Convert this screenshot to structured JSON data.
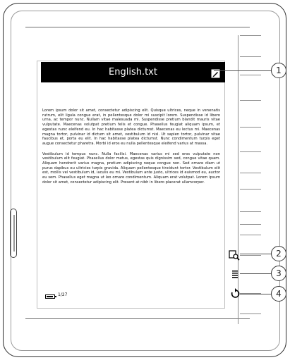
{
  "header": {
    "title": "English.txt"
  },
  "body_text": {
    "paragraphs": [
      "Lorem ipsum dolor sit amet, consectetur adipiscing elit. Quisque ultrices, neque in venenatis rutrum, elit ligula congue erat, in pellentesque dolor mi suscipit lorem. Suspendisse id libero urna, ac tempor nunc. Nullam vitae malesuada mi. Suspendisse pretium blandit mauris vitae vulputate. Maecenas volutpat pretium felis et congue. Phasellus feugiat aliquam ipsum, et egestas nunc eleifend eu. In hac habitasse platea dictumst. Maecenas eu lectus mi. Maecenas magna tortor, pulvinar id dictum sit amet, vestibulum id nisl. Ut sapien tortor, pulvinar vitae faucibus et, porta eu elit. In hac habitasse platea dictumst. Nunc condimentum turpis eget augue consectetur pharetra. Morbi id eros eu nulla pellentesque eleifend varius at massa.",
      "Vestibulum id tempus nunc. Nulla facilisi. Maecenas varius mi sed eros vulputate non vestibulum elit feugiat. Phasellus dolor metus, egestas quis dignissim sed, congue vitae quam. Aliquam hendrerit varius magna, pretium adipiscing neque congue non. Sed ornare diam ut purus dapibus eu ultricies turpis gravida. Aliquam pellentesque tincidunt tortor. Vestibulum elit est, mollis vel vestibulum id, iaculis eu mi. Vestibulum ante justo, ultrices id euismod eu, auctor eu sem. Phasellus eget magna ut leo ornare condimentum. Aliquam erat volutpat. Lorem ipsum dolor sit amet, consectetur adipiscing elit. Present at nibh in libero placerat ullamcorper."
    ]
  },
  "status": {
    "page": "1/27",
    "battery_level": 0.85
  },
  "icons": {
    "edit": "edit-icon",
    "zoom": "zoom-search-icon",
    "menu": "menu-lines-icon",
    "refresh": "rotate-back-icon"
  },
  "callouts": {
    "c1": "1",
    "c2": "2",
    "c3": "3",
    "c4": "4"
  }
}
